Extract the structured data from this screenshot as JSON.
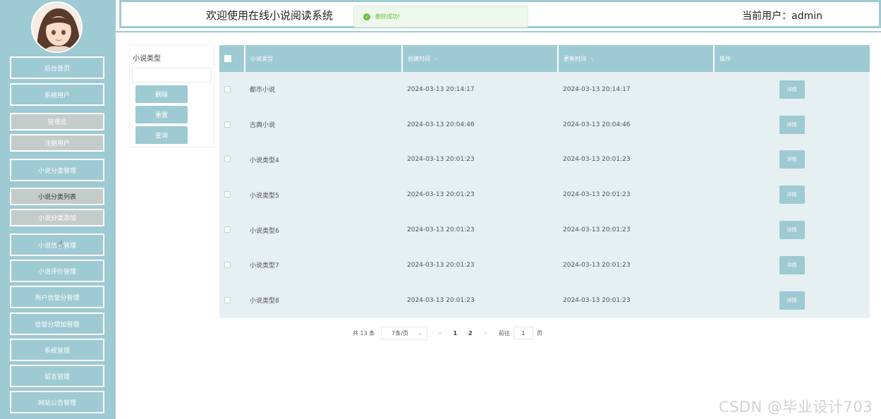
{
  "header": {
    "title": "欢迎使用在线小说阅读系统",
    "current_user": "当前用户：admin"
  },
  "toast": {
    "message": "删除成功!",
    "icon": "check-circle-icon",
    "color": "#67c23a"
  },
  "sidebar": {
    "items": [
      "后台首页",
      "系统用户",
      "管理员",
      "注册用户",
      "小说分类管理",
      "小说分类列表",
      "小说分类添加",
      "小说信息管理",
      "小说评价管理",
      "用户信誉分管理",
      "信誉分增加管理",
      "系统管理",
      "留言管理",
      "网站公告管理"
    ]
  },
  "filter": {
    "label": "小说类型",
    "input_value": "",
    "buttons": {
      "delete": "删除",
      "reset": "重置",
      "search": "查询"
    }
  },
  "table": {
    "headers": [
      "小说类型",
      "创建时间",
      "更新时间",
      "操作"
    ],
    "rows": [
      [
        "都市小说",
        "2024-03-13 20:14:17",
        "2024-03-13 20:14:17"
      ],
      [
        "古典小说",
        "2024-03-13 20:04:46",
        "2024-03-13 20:04:46"
      ],
      [
        "小说类型4",
        "2024-03-13 20:01:23",
        "2024-03-13 20:01:23"
      ],
      [
        "小说类型5",
        "2024-03-13 20:01:23",
        "2024-03-13 20:01:23"
      ],
      [
        "小说类型6",
        "2024-03-13 20:01:23",
        "2024-03-13 20:01:23"
      ],
      [
        "小说类型7",
        "2024-03-13 20:01:23",
        "2024-03-13 20:01:23"
      ],
      [
        "小说类型8",
        "2024-03-13 20:01:23",
        "2024-03-13 20:01:23"
      ]
    ],
    "detail_label": "详情"
  },
  "pager": {
    "total": "共 13 条",
    "page_size": "7条/页",
    "pages": [
      "1",
      "2"
    ],
    "goto_label": "前往",
    "goto_value": "1",
    "page_suffix": "页"
  },
  "watermark": "CSDN @毕业设计703",
  "colors": {
    "accent": "#9ecad3",
    "row_bg": "#e6eff1",
    "sub_btn": "#c4ccca"
  }
}
